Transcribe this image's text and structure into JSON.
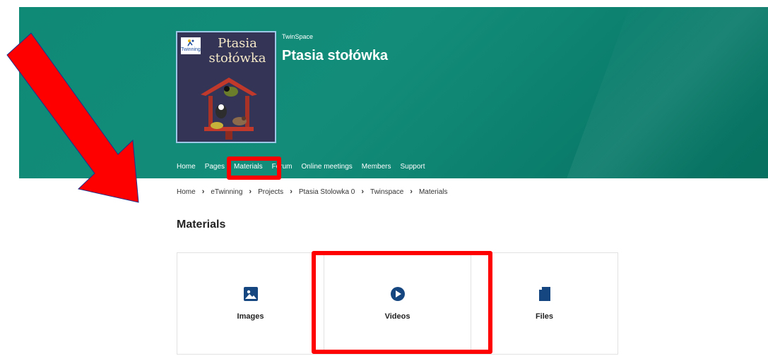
{
  "header": {
    "cover_title_line1": "Ptasia",
    "cover_title_line2": "stołówka",
    "cover_logo_text": "Twinning",
    "twinspace_label": "TwinSpace",
    "project_title": "Ptasia stołówka"
  },
  "nav": {
    "items": [
      {
        "label": "Home"
      },
      {
        "label": "Pages"
      },
      {
        "label": "Materials"
      },
      {
        "label": "Forum"
      },
      {
        "label": "Online meetings"
      },
      {
        "label": "Members"
      },
      {
        "label": "Support"
      }
    ]
  },
  "breadcrumb": {
    "items": [
      "Home",
      "eTwinning",
      "Projects",
      "Ptasia Stolowka 0",
      "Twinspace",
      "Materials"
    ]
  },
  "page": {
    "heading": "Materials"
  },
  "cards": [
    {
      "label": "Images",
      "icon": "image-icon"
    },
    {
      "label": "Videos",
      "icon": "play-icon"
    },
    {
      "label": "Files",
      "icon": "file-icon"
    }
  ],
  "colors": {
    "banner": "#0f8a76",
    "annotation": "#ff0000",
    "icon": "#16467f"
  }
}
